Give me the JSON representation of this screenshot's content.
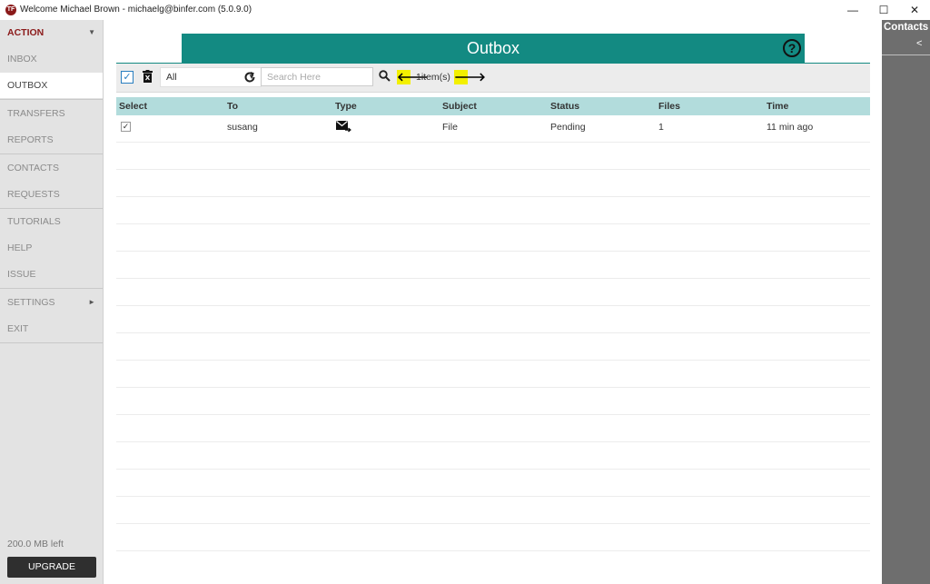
{
  "window": {
    "logo_text": "TF",
    "title": "Welcome  Michael Brown - michaelg@binfer.com (5.0.9.0)",
    "minimize": "—",
    "maximize": "☐",
    "close": "✕"
  },
  "sidebar": {
    "header": "ACTION",
    "items": [
      {
        "label": "INBOX"
      },
      {
        "label": "OUTBOX"
      },
      {
        "label": "TRANSFERS"
      },
      {
        "label": "REPORTS"
      },
      {
        "label": "CONTACTS"
      },
      {
        "label": "REQUESTS"
      },
      {
        "label": "TUTORIALS"
      },
      {
        "label": "HELP"
      },
      {
        "label": "ISSUE"
      },
      {
        "label": "SETTINGS"
      },
      {
        "label": "EXIT"
      }
    ],
    "active": "OUTBOX",
    "storage": "200.0 MB left",
    "upgrade_label": "UPGRADE"
  },
  "header": {
    "title": "Outbox",
    "help": "?"
  },
  "toolbar": {
    "filter_value": "All",
    "search_placeholder": "Search Here",
    "item_count": "1item(s)",
    "prev": "🡐",
    "next": "🡒"
  },
  "table": {
    "columns": [
      "Select",
      "To",
      "Type",
      "Subject",
      "Status",
      "Files",
      "Time"
    ],
    "rows": [
      {
        "selected": true,
        "to": "susang",
        "type": "send-mail-icon",
        "subject": "File",
        "status": "Pending",
        "files": "1",
        "time": "11 min ago"
      }
    ]
  },
  "contacts": {
    "title": "Contacts",
    "collapse": "<"
  },
  "colors": {
    "accent": "#138a82",
    "table_header": "#b2dcdc",
    "brand": "#8b1a1a",
    "highlight": "#f3f000"
  }
}
